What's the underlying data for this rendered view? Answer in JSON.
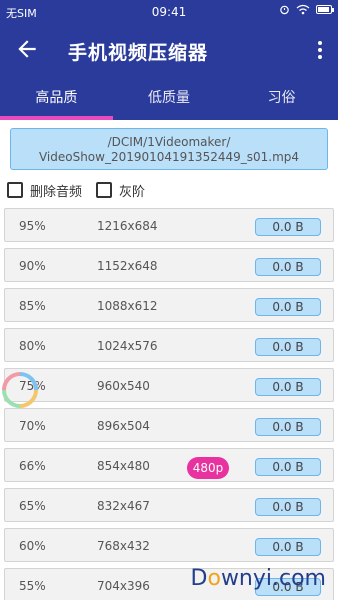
{
  "status_bar": {
    "carrier": "无SIM",
    "time": "09:41"
  },
  "app_bar": {
    "title": "手机视频压缩器"
  },
  "tabs": [
    {
      "label": "高品质"
    },
    {
      "label": "低质量"
    },
    {
      "label": "习俗"
    }
  ],
  "file": {
    "line1": "/DCIM/1Videomaker/",
    "line2": "VideoShow_20190104191352449_s01.mp4"
  },
  "options": {
    "delete_audio": "删除音频",
    "grayscale": "灰阶"
  },
  "rows": [
    {
      "pct": "95%",
      "res": "1216x684",
      "size": "0.0  B"
    },
    {
      "pct": "90%",
      "res": "1152x648",
      "size": "0.0  B"
    },
    {
      "pct": "85%",
      "res": "1088x612",
      "size": "0.0  B"
    },
    {
      "pct": "80%",
      "res": "1024x576",
      "size": "0.0  B"
    },
    {
      "pct": "75%",
      "res": "960x540",
      "size": "0.0  B"
    },
    {
      "pct": "70%",
      "res": "896x504",
      "size": "0.0  B"
    },
    {
      "pct": "66%",
      "res": "854x480",
      "size": "0.0  B"
    },
    {
      "pct": "65%",
      "res": "832x467",
      "size": "0.0  B"
    },
    {
      "pct": "60%",
      "res": "768x432",
      "size": "0.0  B"
    },
    {
      "pct": "55%",
      "res": "704x396",
      "size": "0.0  B"
    }
  ],
  "badge": "480p",
  "watermark": {
    "pre": "D",
    "o": "o",
    "post": "wnyi.com"
  },
  "colors": {
    "primary": "#2a3b9c",
    "accent": "#e74bbd",
    "badge": "#e7329f",
    "chip": "#b9dff9"
  }
}
